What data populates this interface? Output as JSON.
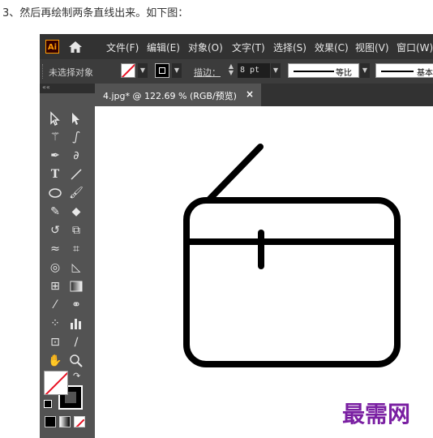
{
  "caption": "3、然后再绘制两条直线出来。如下图：",
  "app": {
    "logo": "Ai"
  },
  "menubar": {
    "items": [
      "文件(F)",
      "编辑(E)",
      "对象(O)",
      "文字(T)",
      "选择(S)",
      "效果(C)",
      "视图(V)",
      "窗口(W)"
    ]
  },
  "control_bar": {
    "selection_label": "未选择对象",
    "stroke_label": "描边：",
    "stroke_value": "8 pt",
    "profile1_label": "等比",
    "profile2_label": "基本"
  },
  "panel": {
    "collapse": "««"
  },
  "document": {
    "tab_title": "4.jpg* @ 122.69 % (RGB/预览)",
    "close": "×"
  },
  "tools": [
    "selection-tool",
    "direct-selection-tool",
    "magic-wand-tool",
    "lasso-tool",
    "pen-tool",
    "curvature-tool",
    "type-tool",
    "line-segment-tool",
    "ellipse-tool",
    "paintbrush-tool",
    "shaper-tool",
    "eraser-tool",
    "rotate-tool",
    "scale-tool",
    "width-tool",
    "free-transform-tool",
    "shape-builder-tool",
    "perspective-grid-tool",
    "mesh-tool",
    "gradient-tool",
    "eyedropper-tool",
    "blend-tool",
    "symbol-sprayer-tool",
    "column-graph-tool",
    "artboard-tool",
    "slice-tool",
    "hand-tool",
    "zoom-tool"
  ],
  "colors": {
    "fill": "none",
    "stroke": "#000000",
    "none_slash": "#e81123",
    "watermark": "#7a1fa2"
  },
  "watermark": "最需网"
}
